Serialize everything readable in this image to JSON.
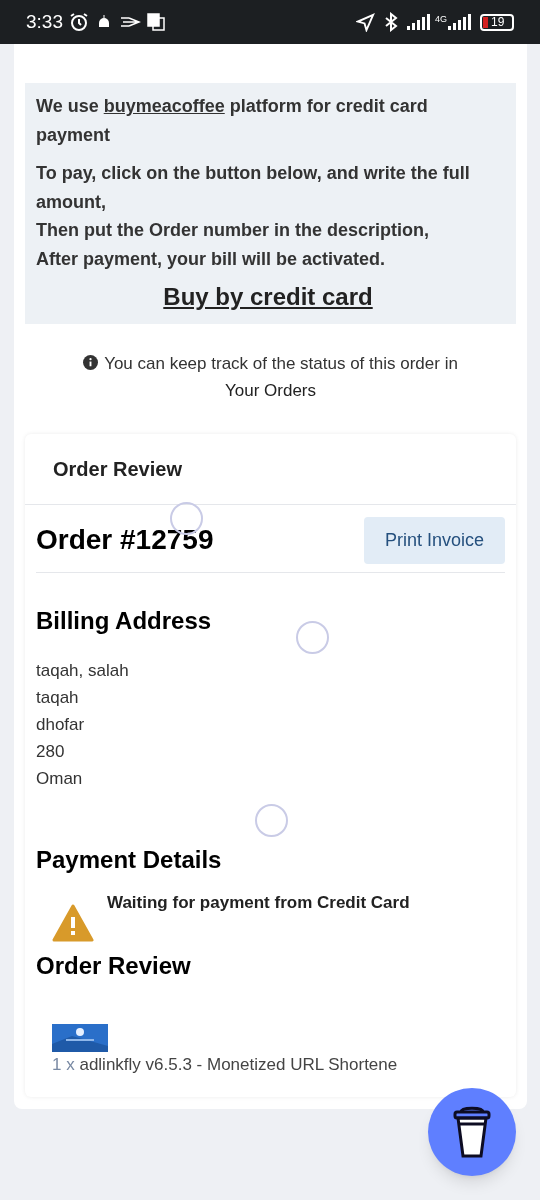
{
  "status_bar": {
    "time": "3:33",
    "network": "4G",
    "battery": "19"
  },
  "payment_info": {
    "paragraphs": [
      "We use **buymeacoffee** platform for credit card payment",
      "To pay, click on the button below, and write the full amount,\nThen put the Order number in the description,\nAfter payment, your bill will be activated."
    ],
    "link": "Buy by credit card"
  },
  "notice": {
    "text": "You can keep track of the status of this order in",
    "link": "Your Orders"
  },
  "order_card": {
    "header": "Order Review",
    "order_number": "Order #12759",
    "print_button": "Print Invoice",
    "billing": {
      "title": "Billing Address",
      "lines": [
        "taqah, salah",
        "taqah",
        "dhofar",
        "280",
        "Oman"
      ]
    },
    "payment": {
      "title": "Payment Details",
      "status": "Waiting for payment from Credit Card"
    },
    "review": {
      "title": "Order Review",
      "items": [
        {
          "quantity": "1 x",
          "name": "adlinkfly v6.5.3 - Monetized URL Shortene"
        }
      ]
    }
  }
}
